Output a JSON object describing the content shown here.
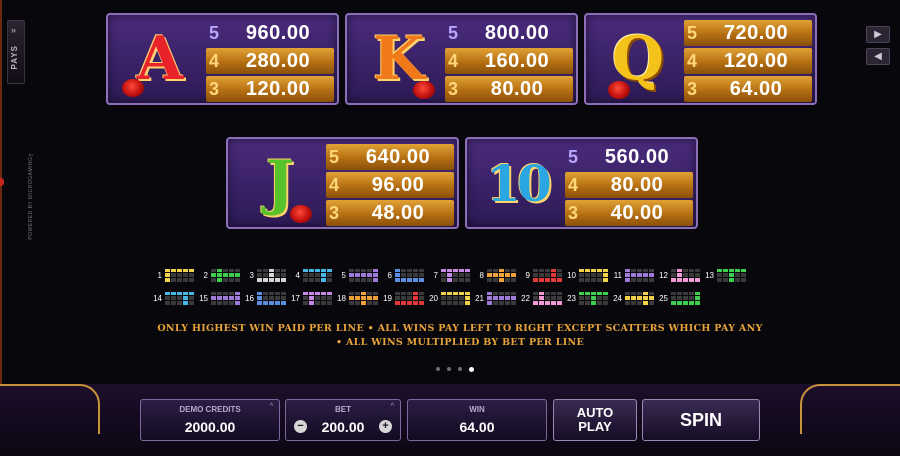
{
  "side_tab": {
    "label": "PAYS",
    "chevron": "»"
  },
  "powered_text": "POWERED BY MICROGAMING™",
  "nav": {
    "next": "▶",
    "prev": "◀"
  },
  "symbols": [
    {
      "symbol": "A",
      "color": "#e8232a",
      "pays": [
        {
          "count": "5",
          "value": "960.00"
        },
        {
          "count": "4",
          "value": "280.00"
        },
        {
          "count": "3",
          "value": "120.00"
        }
      ]
    },
    {
      "symbol": "K",
      "color": "#f07a1a",
      "pays": [
        {
          "count": "5",
          "value": "800.00"
        },
        {
          "count": "4",
          "value": "160.00"
        },
        {
          "count": "3",
          "value": "80.00"
        }
      ]
    },
    {
      "symbol": "Q",
      "color": "#f5c21b",
      "pays": [
        {
          "count": "5",
          "value": "720.00"
        },
        {
          "count": "4",
          "value": "120.00"
        },
        {
          "count": "3",
          "value": "64.00"
        }
      ]
    },
    {
      "symbol": "J",
      "color": "#57c22a",
      "pays": [
        {
          "count": "5",
          "value": "640.00"
        },
        {
          "count": "4",
          "value": "96.00"
        },
        {
          "count": "3",
          "value": "48.00"
        }
      ]
    },
    {
      "symbol": "10",
      "color": "#2aa6e3",
      "pays": [
        {
          "count": "5",
          "value": "560.00"
        },
        {
          "count": "4",
          "value": "80.00"
        },
        {
          "count": "3",
          "value": "40.00"
        }
      ]
    }
  ],
  "paylines": {
    "row1": [
      "1",
      "2",
      "3",
      "4",
      "5",
      "6",
      "7",
      "8",
      "9",
      "10",
      "11",
      "12",
      "13"
    ],
    "row2": [
      "14",
      "15",
      "16",
      "17",
      "18",
      "19",
      "20",
      "21",
      "22",
      "23",
      "24",
      "25"
    ]
  },
  "rules": {
    "line1": "ONLY HIGHEST WIN PAID PER LINE  • ALL WINS PAY LEFT TO RIGHT EXCEPT SCATTERS WHICH PAY ANY",
    "line2": "• ALL WINS MULTIPLIED BY BET PER LINE"
  },
  "pagination": {
    "pages": 4,
    "active": 4
  },
  "bottom_bar": {
    "demo_credits_label": "DEMO CREDITS",
    "demo_credits_value": "2000.00",
    "bet_label": "BET",
    "bet_value": "200.00",
    "bet_minus": "−",
    "bet_plus": "+",
    "win_label": "WIN",
    "win_value": "64.00",
    "autoplay_line1": "AUTO",
    "autoplay_line2": "PLAY",
    "spin_label": "SPIN",
    "caret": "^"
  }
}
